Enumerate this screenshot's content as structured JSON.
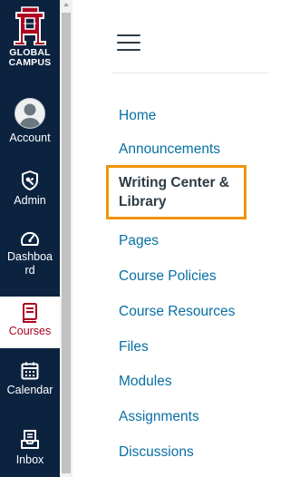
{
  "global_nav": {
    "logo_letter": "A",
    "logo_text_line1": "GLOBAL",
    "logo_text_line2": "CAMPUS",
    "items": [
      {
        "label": "Account",
        "icon": "avatar-icon"
      },
      {
        "label": "Admin",
        "icon": "admin-shield-icon"
      },
      {
        "label_line1": "Dashboa",
        "label_line2": "rd",
        "icon": "dashboard-speedometer-icon"
      },
      {
        "label": "Courses",
        "icon": "courses-book-icon",
        "active": true
      },
      {
        "label": "Calendar",
        "icon": "calendar-icon"
      },
      {
        "label": "Inbox",
        "icon": "inbox-icon"
      }
    ]
  },
  "course_nav": {
    "items": [
      {
        "label": "Home"
      },
      {
        "label": "Announcements"
      },
      {
        "label": "Writing Center & Library",
        "current": true
      },
      {
        "label": "Pages"
      },
      {
        "label": "Course Policies"
      },
      {
        "label": "Course Resources"
      },
      {
        "label": "Files"
      },
      {
        "label": "Modules"
      },
      {
        "label": "Assignments"
      },
      {
        "label": "Discussions"
      }
    ]
  },
  "colors": {
    "nav_background": "#0c2340",
    "brand_red": "#ab0520",
    "link_blue": "#0770a3",
    "text_dark": "#2d3b45",
    "highlight_orange": "#f0940a"
  }
}
